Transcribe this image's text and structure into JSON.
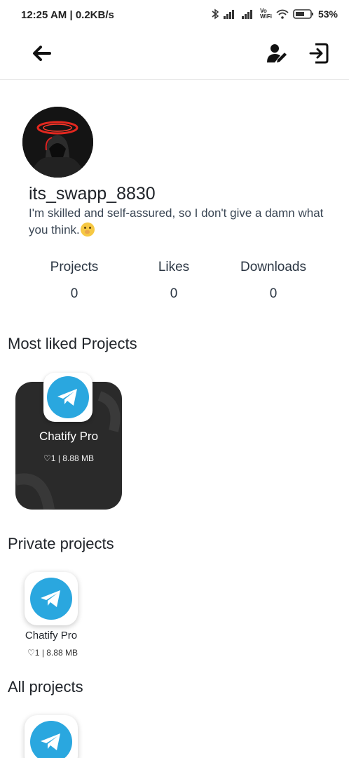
{
  "status_bar": {
    "time": "12:25 AM | 0.2KB/s",
    "battery": "53%",
    "icons": [
      "bluetooth-icon",
      "signal-icon",
      "signal-icon",
      "vowifi-icon",
      "wifi-icon",
      "battery-icon"
    ],
    "vowifi_top": "Vo",
    "vowifi_bottom": "WiFi"
  },
  "app_bar": {
    "icons": [
      "back-arrow-icon",
      "edit-profile-icon",
      "logout-icon"
    ]
  },
  "profile": {
    "username": "its_swapp_8830",
    "bio": "I'm skilled and self-assured, so I don't give a damn what you think."
  },
  "stats": {
    "projects_label": "Projects",
    "projects_value": "0",
    "likes_label": "Likes",
    "likes_value": "0",
    "downloads_label": "Downloads",
    "downloads_value": "0"
  },
  "sections": {
    "most_liked": "Most liked Projects",
    "private": "Private projects",
    "all": "All projects"
  },
  "most_liked_project": {
    "name": "Chatify Pro",
    "meta": "♡1 | 8.88 MB"
  },
  "private_project": {
    "name": "Chatify Pro",
    "meta": "♡1 | 8.88 MB"
  },
  "colors": {
    "telegram": "#2aa7df",
    "card_bg": "#2a2a2a"
  }
}
